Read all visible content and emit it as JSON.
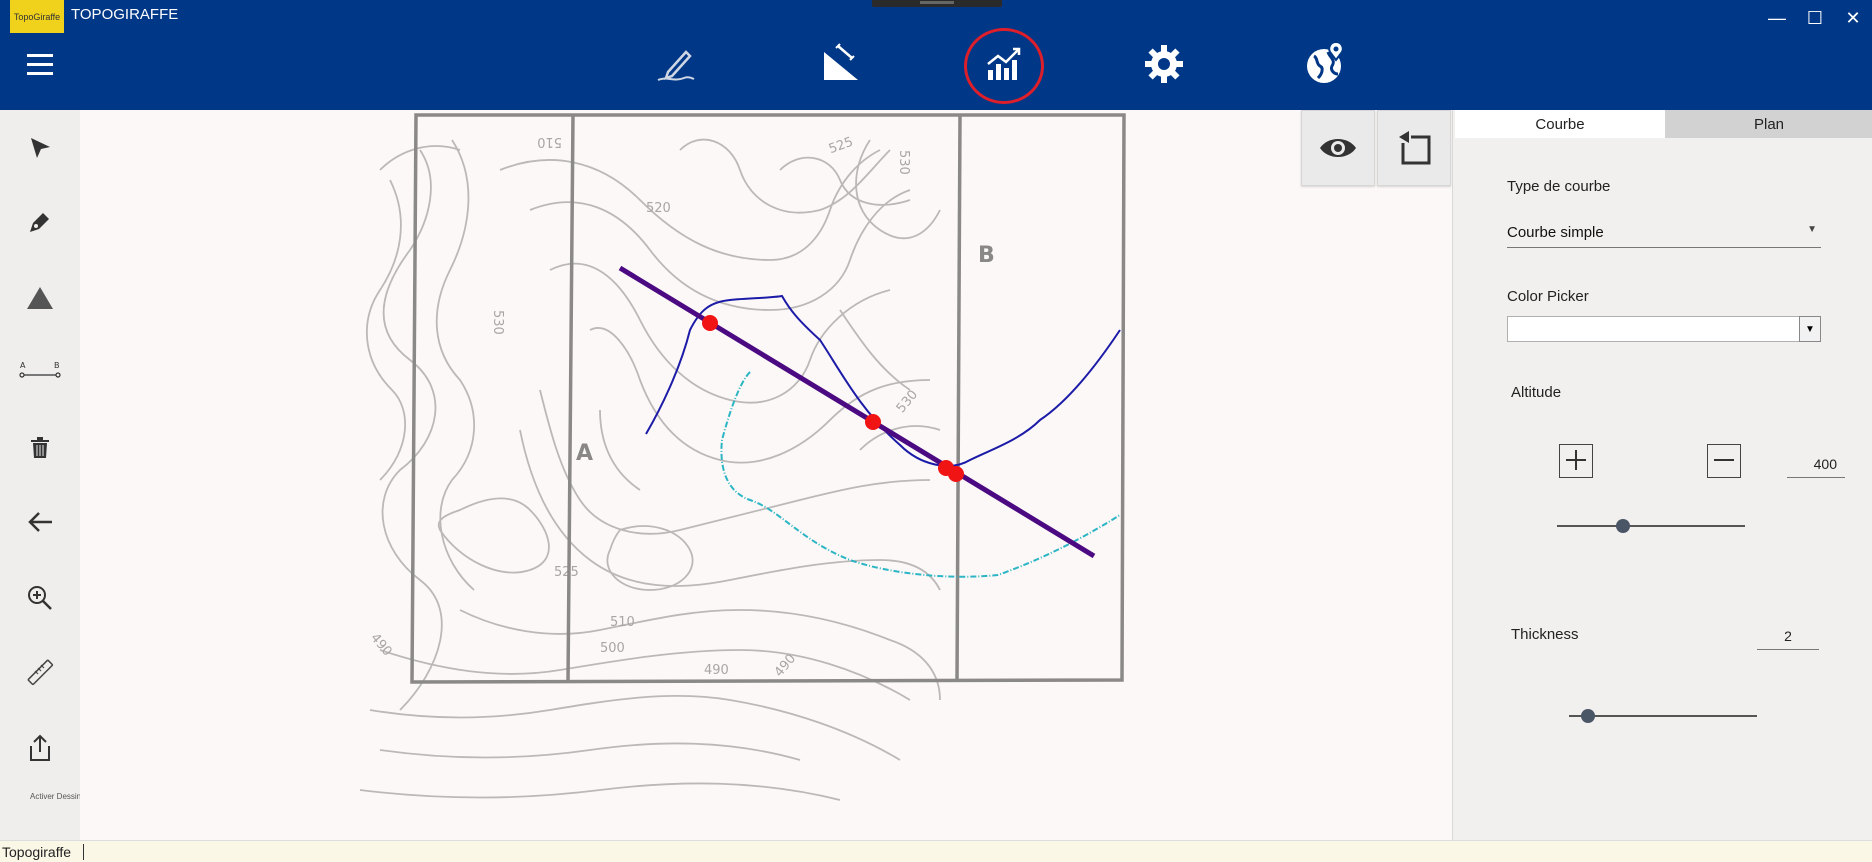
{
  "app": {
    "title": "TOPOGIRAFFE",
    "logo_text": "TopoGiraffe"
  },
  "window_controls": {
    "minimize": "—",
    "maximize": "☐",
    "close": "✕"
  },
  "header": {
    "menu_icon": "hamburger-icon",
    "tools": [
      {
        "name": "draw-tool",
        "icon": "pen-line-icon"
      },
      {
        "name": "slope-tool",
        "icon": "slope-triangle-icon"
      },
      {
        "name": "profile-chart-tool",
        "icon": "bar-chart-icon",
        "highlighted": true
      },
      {
        "name": "settings-tool",
        "icon": "gear-icon"
      },
      {
        "name": "geo-location-tool",
        "icon": "globe-pin-icon"
      }
    ]
  },
  "left_toolbar": {
    "tools": [
      "select-arrow-icon",
      "pen-icon",
      "triangle-icon",
      "segment-ab-icon",
      "trash-icon",
      "back-arrow-icon",
      "zoom-in-icon",
      "ruler-icon",
      "export-icon"
    ],
    "activer_label": "Activer Dessin"
  },
  "map": {
    "point_labels": {
      "a": "A",
      "b": "B"
    },
    "contour_labels": [
      "510",
      "520",
      "530",
      "525",
      "530",
      "530",
      "525",
      "510",
      "500",
      "490",
      "490",
      "490"
    ],
    "colors": {
      "profile_line": "#4b0a82",
      "blue_curve": "#1b1ba8",
      "teal_curve": "#27b6c5",
      "point": "#f01414",
      "contour": "#b9b6b6"
    }
  },
  "view_buttons": {
    "eye": "eye-icon",
    "reset": "reset-view-icon"
  },
  "panel": {
    "tabs": [
      {
        "label": "Courbe",
        "active": true
      },
      {
        "label": "Plan",
        "active": false
      }
    ],
    "type_label": "Type de courbe",
    "type_value": "Courbe simple",
    "color_label": "Color Picker",
    "altitude_label": "Altitude",
    "altitude_value": "400",
    "altitude_fraction": 0.35,
    "thickness_label": "Thickness",
    "thickness_value": "2",
    "thickness_fraction": 0.1
  },
  "status_bar": {
    "text": "Topogiraffe"
  }
}
